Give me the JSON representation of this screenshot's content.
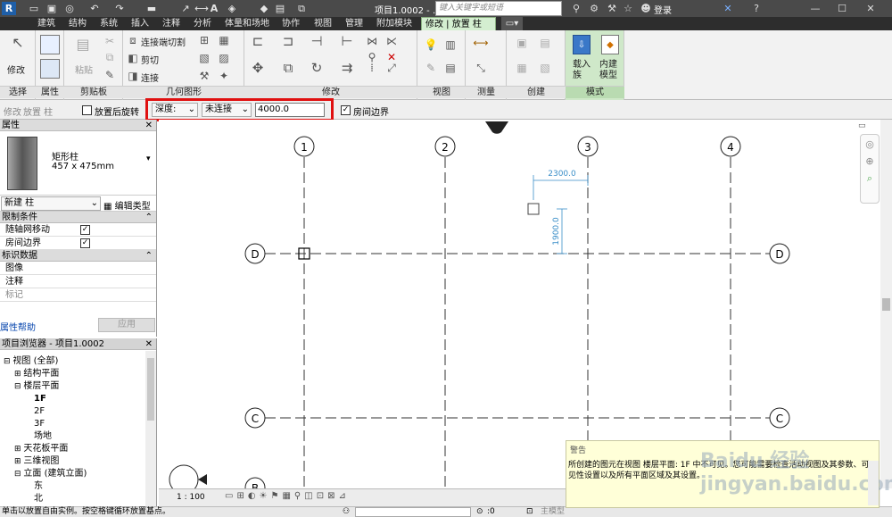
{
  "titlebar": {
    "quick_access_icons": [
      "revit-logo",
      "open",
      "save",
      "sync",
      "undo",
      "redo",
      "print",
      "measure",
      "dimension",
      "text",
      "3d-view",
      "section",
      "close-hidden",
      "switch-windows"
    ],
    "doc_title": "项目1.0002 - ...",
    "search_placeholder": "键入关键字或短语",
    "login_label": "登录"
  },
  "tabs": [
    "建筑",
    "结构",
    "系统",
    "插入",
    "注释",
    "分析",
    "体量和场地",
    "协作",
    "视图",
    "管理",
    "附加模块"
  ],
  "active_tab": "修改 | 放置 柱",
  "ribbon": {
    "modify_label": "修改",
    "paste_label": "粘贴",
    "cut_join_label": "连接端切割",
    "cut_label": "剪切",
    "join_label": "连接",
    "load_family_label": "载入族",
    "inplace_model_label": "内建模型",
    "panels": {
      "select": "选择",
      "properties": "属性",
      "clipboard": "剪贴板",
      "geometry": "几何图形",
      "modify": "修改",
      "view": "视图",
      "measure": "测量",
      "create": "创建",
      "mode": "模式"
    }
  },
  "optbar": {
    "modify_label": "修改",
    "place_column_label": "放置 柱",
    "rotate_label": "放置后旋转",
    "depth_label": "深度:",
    "connect_label": "未连接",
    "value": "4000.0",
    "room_bounding_label": "房间边界"
  },
  "properties": {
    "title": "属性",
    "family_name": "矩形柱",
    "type_name": "457 x 475mm",
    "instance_selector": "新建 柱",
    "edit_type_label": "编辑类型",
    "groups": [
      {
        "name": "限制条件",
        "rows": [
          {
            "label": "随轴网移动",
            "checked": true
          },
          {
            "label": "房间边界",
            "checked": true
          }
        ]
      },
      {
        "name": "标识数据",
        "rows": [
          {
            "label": "图像"
          },
          {
            "label": "注释"
          },
          {
            "label": "标记"
          }
        ]
      }
    ],
    "help_link": "属性帮助",
    "apply_label": "应用"
  },
  "browser": {
    "title": "项目浏览器 - 项目1.0002",
    "items": [
      {
        "label": "视图 (全部)",
        "level": 0,
        "toggle": "⊟"
      },
      {
        "label": "结构平面",
        "level": 1,
        "toggle": "⊞"
      },
      {
        "label": "楼层平面",
        "level": 1,
        "toggle": "⊟"
      },
      {
        "label": "1F",
        "level": 2,
        "bold": true
      },
      {
        "label": "2F",
        "level": 2
      },
      {
        "label": "3F",
        "level": 2
      },
      {
        "label": "场地",
        "level": 2
      },
      {
        "label": "天花板平面",
        "level": 1,
        "toggle": "⊞"
      },
      {
        "label": "三维视图",
        "level": 1,
        "toggle": "⊞"
      },
      {
        "label": "立面 (建筑立面)",
        "level": 1,
        "toggle": "⊟"
      },
      {
        "label": "东",
        "level": 2
      },
      {
        "label": "北",
        "level": 2
      }
    ]
  },
  "canvas": {
    "grid_labels_top": [
      "1",
      "2",
      "3",
      "4"
    ],
    "grid_labels_side": [
      "D",
      "C",
      "B"
    ],
    "dim_horizontal": "2300.0",
    "dim_vertical": "1900.0"
  },
  "viewbar": {
    "scale": "1 : 100"
  },
  "statusbar": {
    "message": "单击以放置自由实例。按空格键循环放置基点。",
    "coord": ":0",
    "model_label": "主模型"
  },
  "warning": {
    "title": "警告",
    "body": "所创建的图元在视图 楼层平面: 1F 中不可见。您可能需要检查活动视图及其参数、可见性设置以及所有平面区域及其设置。"
  },
  "watermark": "Baidu 经验 jingyan.baidu.com"
}
